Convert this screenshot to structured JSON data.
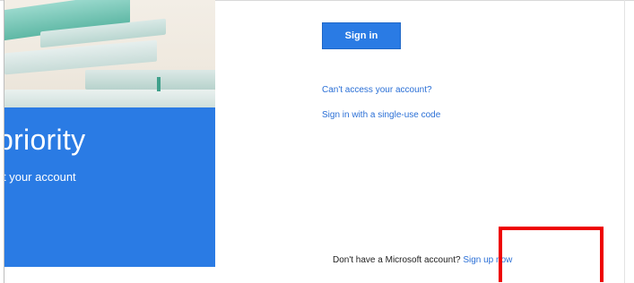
{
  "hero": {
    "title": "priority",
    "subtitle": "t your account"
  },
  "signin": {
    "button_label": "Sign in"
  },
  "links": {
    "cant_access": "Can't access your account?",
    "single_use_code": "Sign in with a single-use code"
  },
  "signup": {
    "prompt": "Don't have a Microsoft account?",
    "link_label": "Sign up now"
  },
  "colors": {
    "accent_blue": "#2a7be4",
    "link_blue": "#2a6fd6",
    "highlight_red": "#ee0000"
  }
}
